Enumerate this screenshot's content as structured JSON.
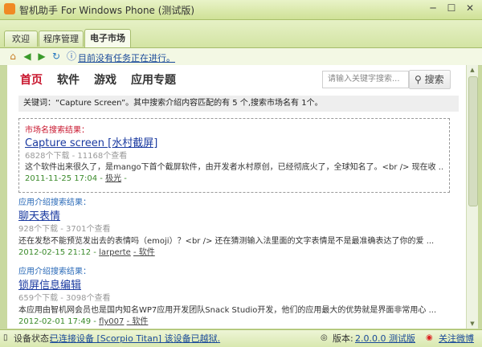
{
  "window": {
    "title": "智机助手 For Windows Phone (测试版)",
    "minimize": "─",
    "maximize": "☐",
    "close": "✕"
  },
  "tabs": [
    {
      "label": "欢迎"
    },
    {
      "label": "程序管理"
    },
    {
      "label": "电子市场"
    }
  ],
  "toolbar": {
    "status_tip": "目前没有任务正在进行。",
    "icons": [
      "home-icon",
      "back-icon",
      "forward-icon",
      "refresh-icon",
      "info-icon"
    ]
  },
  "nav": {
    "items": [
      "首页",
      "软件",
      "游戏",
      "应用专题"
    ],
    "active_index": 0
  },
  "search": {
    "placeholder": "请输入关键字搜索...",
    "button_label": "搜索"
  },
  "keyword_bar": "关键词：“Capture Screen”。其中搜索介绍内容匹配的有 5 个,搜索市场名有 1个。",
  "market_result": {
    "section_label": "市场名搜索结果：",
    "title": "Capture screen [水村截屏]",
    "meta": "6828个下载 - 11168个查看",
    "desc": "这个软件出来很久了，是mango下首个截屏软件，由开发者水村原创，已经彻底火了，全球知名了。<br /> 现在收 ...",
    "date": "2011-11-25 17:04 -",
    "author": "极光",
    "tail": "-"
  },
  "intro_results": [
    {
      "section_label": "应用介绍搜索结果：",
      "title": "聊天表情",
      "meta": "928个下载 - 3701个查看",
      "desc": "还在发愁不能预览发出去的表情吗（emoji）？<br /> 还在猜测输入法里面的文字表情是不是最准确表达了你的爱 ...",
      "date": "2012-02-15 21:12 -",
      "author": "larperte",
      "tail": "- 软件"
    },
    {
      "section_label": "应用介绍搜索结果：",
      "title": "锁屏信息编辑",
      "meta": "659个下载 - 3098个查看",
      "desc": "本应用由智机网会员也是国内知名WP7应用开发团队Snack Studio开发，他们的应用最大的优势就是界面非常用心 ...",
      "date": "2012-02-01 17:49 -",
      "author": "fly007",
      "tail": "- 软件"
    }
  ],
  "statusbar": {
    "device_label": "设备状态:",
    "device_status": "已连接设备 [Scorpio Titan] 该设备已越狱.",
    "version_label": "版本:",
    "version_value": "2.0.0.0 测试版",
    "follow_label": "关注微博"
  }
}
